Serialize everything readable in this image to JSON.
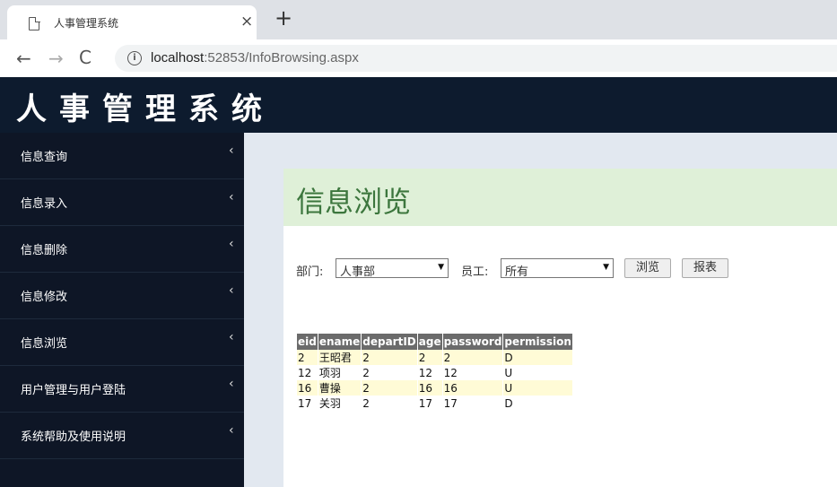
{
  "browser": {
    "tab_title": "人事管理系统",
    "tab_close": "×",
    "new_tab": "+",
    "back": "←",
    "forward": "→",
    "reload": "C",
    "info": "i",
    "url_host": "localhost",
    "url_rest": ":52853/InfoBrowsing.aspx"
  },
  "app": {
    "title": "人事管理系统"
  },
  "sidebar": {
    "chevron": "‹",
    "items": [
      {
        "label": "信息查询"
      },
      {
        "label": "信息录入"
      },
      {
        "label": "信息删除"
      },
      {
        "label": "信息修改"
      },
      {
        "label": "信息浏览"
      },
      {
        "label": "用户管理与用户登陆"
      },
      {
        "label": "系统帮助及使用说明"
      }
    ]
  },
  "main": {
    "heading": "信息浏览",
    "department_label": "部门:",
    "department_value": "人事部",
    "employee_label": "员工:",
    "employee_value": "所有",
    "browse_button": "浏览",
    "report_button": "报表",
    "dropdown_arrow": "▼"
  },
  "table": {
    "columns": [
      "eid",
      "ename",
      "departID",
      "age",
      "password",
      "permission"
    ],
    "rows": [
      [
        "2",
        "王昭君",
        "2",
        "2",
        "2",
        "D"
      ],
      [
        "12",
        "项羽",
        "2",
        "12",
        "12",
        "U"
      ],
      [
        "16",
        "曹操",
        "2",
        "16",
        "16",
        "U"
      ],
      [
        "17",
        "关羽",
        "2",
        "17",
        "17",
        "D"
      ]
    ]
  }
}
